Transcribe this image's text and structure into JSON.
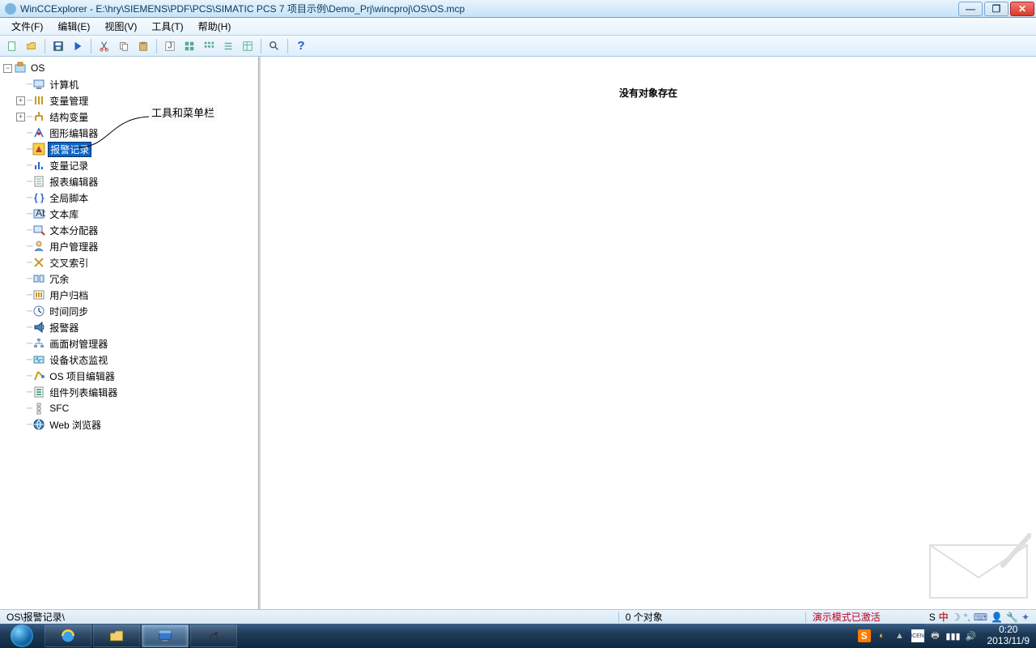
{
  "title": "WinCCExplorer - E:\\hry\\SIEMENS\\PDF\\PCS\\SIMATIC PCS 7 项目示例\\Demo_Prj\\wincproj\\OS\\OS.mcp",
  "menu": {
    "file": "文件(F)",
    "edit": "编辑(E)",
    "view": "视图(V)",
    "tools": "工具(T)",
    "help": "帮助(H)"
  },
  "annotation": "工具和菜单栏",
  "content_message": "没有对象存在",
  "tree": {
    "root": "OS",
    "items": [
      {
        "label": "计算机",
        "icon": "computer",
        "expand": null
      },
      {
        "label": "变量管理",
        "icon": "tagmgmt",
        "expand": "plus"
      },
      {
        "label": "结构变量",
        "icon": "struct",
        "expand": "plus"
      },
      {
        "label": "图形编辑器",
        "icon": "graphics",
        "expand": null
      },
      {
        "label": "报警记录",
        "icon": "alarm",
        "expand": null,
        "selected": true
      },
      {
        "label": "变量记录",
        "icon": "taglog",
        "expand": null
      },
      {
        "label": "报表编辑器",
        "icon": "report",
        "expand": null
      },
      {
        "label": "全局脚本",
        "icon": "script",
        "expand": null
      },
      {
        "label": "文本库",
        "icon": "textlib",
        "expand": null
      },
      {
        "label": "文本分配器",
        "icon": "textdist",
        "expand": null
      },
      {
        "label": "用户管理器",
        "icon": "useradm",
        "expand": null
      },
      {
        "label": "交叉索引",
        "icon": "xref",
        "expand": null
      },
      {
        "label": "冗余",
        "icon": "redund",
        "expand": null
      },
      {
        "label": "用户归档",
        "icon": "userarch",
        "expand": null
      },
      {
        "label": "时间同步",
        "icon": "timesync",
        "expand": null
      },
      {
        "label": "报警器",
        "icon": "horn",
        "expand": null
      },
      {
        "label": "画面树管理器",
        "icon": "pictree",
        "expand": null
      },
      {
        "label": "设备状态监视",
        "icon": "lifebeat",
        "expand": null
      },
      {
        "label": "OS 项目编辑器",
        "icon": "osproj",
        "expand": null
      },
      {
        "label": "组件列表编辑器",
        "icon": "complist",
        "expand": null
      },
      {
        "label": "SFC",
        "icon": "sfc",
        "expand": null
      },
      {
        "label": "Web 浏览器",
        "icon": "web",
        "expand": null
      }
    ]
  },
  "status": {
    "path": "OS\\报警记录\\",
    "count": "0 个对象",
    "demo": "演示模式已激活"
  },
  "tray": {
    "ime_s": "S",
    "ime_cn": "中",
    "time": "0:20",
    "date": "2013/11/9",
    "license": "ICEN"
  },
  "winbtn": {
    "min": "—",
    "max": "❐",
    "close": "✕"
  },
  "help_glyph": "?"
}
